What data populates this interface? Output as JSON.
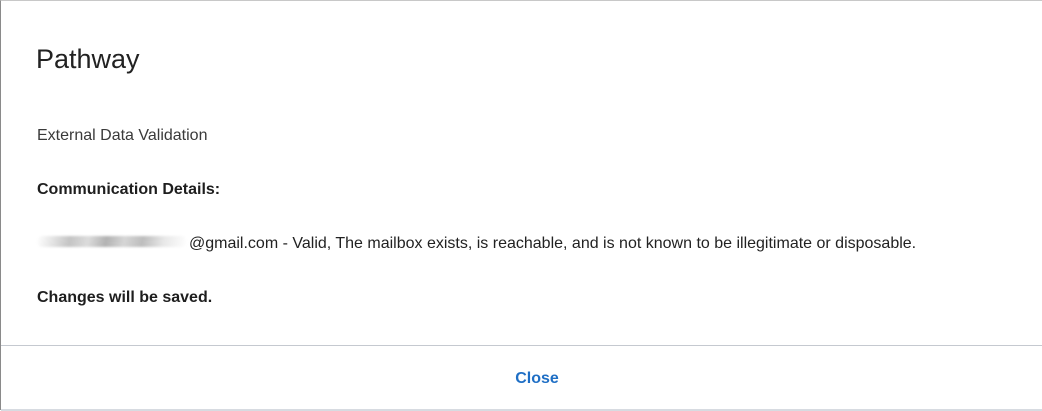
{
  "dialog": {
    "title": "Pathway",
    "subtitle": "External Data Validation",
    "section_heading": "Communication Details:",
    "detail": {
      "email_suffix": "@gmail.com",
      "message": " - Valid, The mailbox exists, is reachable, and is not known to be illegitimate or disposable."
    },
    "notice": "Changes will be saved.",
    "close_label": "Close"
  },
  "colors": {
    "accent": "#1f6fc5",
    "text": "#222222",
    "divider": "#c5c9d0"
  }
}
